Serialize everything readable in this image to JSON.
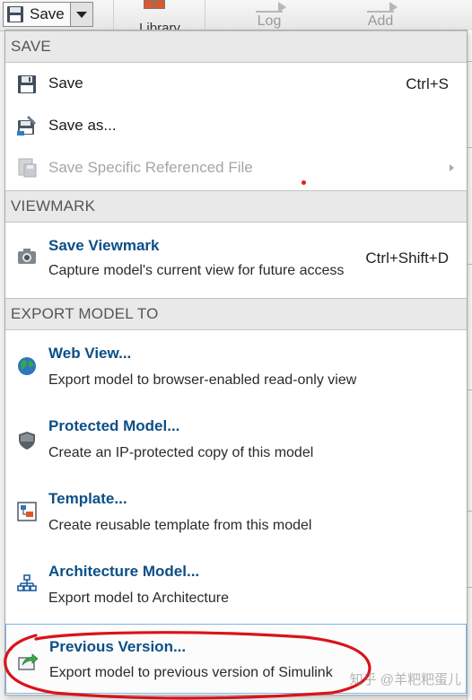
{
  "toolstrip": {
    "save_label": "Save",
    "library_label": "Library",
    "log_label": "Log",
    "add_label": "Add"
  },
  "menu": {
    "sections": [
      {
        "header": "SAVE"
      },
      {
        "header": "VIEWMARK"
      },
      {
        "header": "EXPORT MODEL TO"
      }
    ],
    "save_items": [
      {
        "label": "Save",
        "shortcut": "Ctrl+S",
        "icon": "floppy-disk-icon"
      },
      {
        "label": "Save as...",
        "icon": "save-as-icon"
      },
      {
        "label": "Save Specific Referenced File",
        "icon": "referenced-file-icon",
        "disabled": true,
        "has_submenu": true
      }
    ],
    "viewmark": {
      "title": "Save Viewmark",
      "description": "Capture model's current view for future access",
      "shortcut": "Ctrl+Shift+D",
      "icon": "camera-icon"
    },
    "export_items": [
      {
        "title": "Web View...",
        "description": "Export model to browser-enabled read-only view",
        "icon": "globe-icon"
      },
      {
        "title": "Protected Model...",
        "description": "Create an IP-protected copy of this model",
        "icon": "shield-icon"
      },
      {
        "title": "Template...",
        "description": "Create reusable template from this model",
        "icon": "template-icon"
      },
      {
        "title": "Architecture Model...",
        "description": "Export model to Architecture",
        "icon": "architecture-icon"
      },
      {
        "title": "Previous Version...",
        "description": "Export model to previous version of Simulink",
        "icon": "previous-version-icon"
      }
    ]
  },
  "colors": {
    "title_blue": "#0b4f86",
    "header_bg": "#e9e9e9",
    "highlight_border": "#7db5e3",
    "annotation_red": "#d9141b"
  },
  "watermark": "知乎 @羊粑粑蛋儿"
}
